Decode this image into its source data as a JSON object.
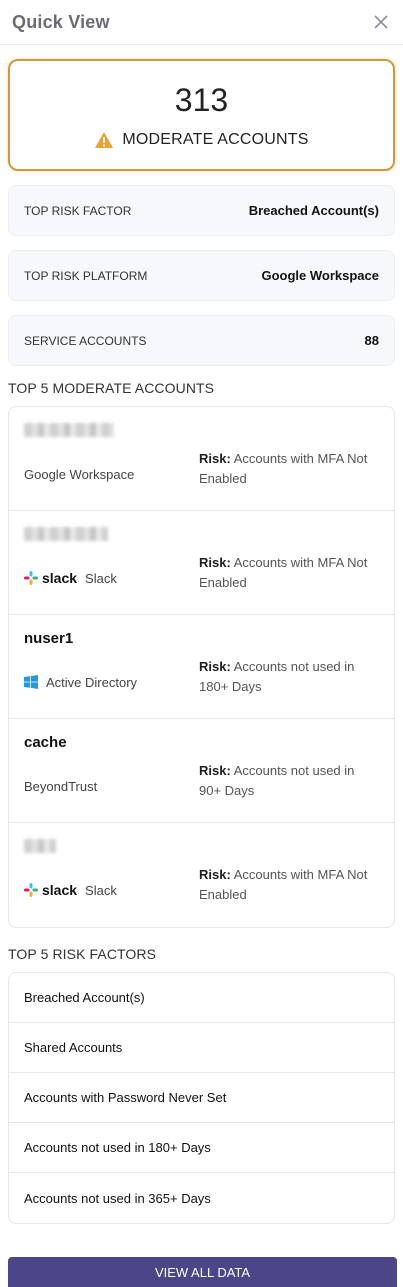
{
  "header": {
    "title": "Quick View"
  },
  "summary": {
    "count": "313",
    "label": "MODERATE ACCOUNTS",
    "accent": "#d09a3c"
  },
  "stats": [
    {
      "label": "TOP RISK FACTOR",
      "value": "Breached Account(s)"
    },
    {
      "label": "TOP RISK PLATFORM",
      "value": "Google Workspace"
    },
    {
      "label": "SERVICE ACCOUNTS",
      "value": "88"
    }
  ],
  "top_accounts": {
    "title": "TOP 5 MODERATE ACCOUNTS",
    "risk_prefix": "Risk:",
    "items": [
      {
        "name": "",
        "platform": "Google Workspace",
        "platform_icon": "none",
        "risk": "Accounts with MFA Not Enabled"
      },
      {
        "name": "",
        "platform": "Slack",
        "platform_icon": "slack-logo",
        "logo_text": "slack",
        "risk": "Accounts with MFA Not Enabled"
      },
      {
        "name": "nuser1",
        "platform": "Active Directory",
        "platform_icon": "windows-icon",
        "risk": "Accounts not used in 180+ Days"
      },
      {
        "name": "cache",
        "platform": "BeyondTrust",
        "platform_icon": "none",
        "risk": "Accounts not used in 90+ Days"
      },
      {
        "name": "",
        "platform": "Slack",
        "platform_icon": "slack-logo",
        "logo_text": "slack",
        "risk": "Accounts with MFA Not Enabled"
      }
    ]
  },
  "top_factors": {
    "title": "TOP 5 RISK FACTORS",
    "items": [
      "Breached Account(s)",
      "Shared Accounts",
      "Accounts with Password Never Set",
      "Accounts not used in 180+ Days",
      "Accounts not used in 365+ Days"
    ]
  },
  "footer": {
    "view_all_label": "VIEW ALL DATA",
    "button_color": "#4a4688"
  }
}
